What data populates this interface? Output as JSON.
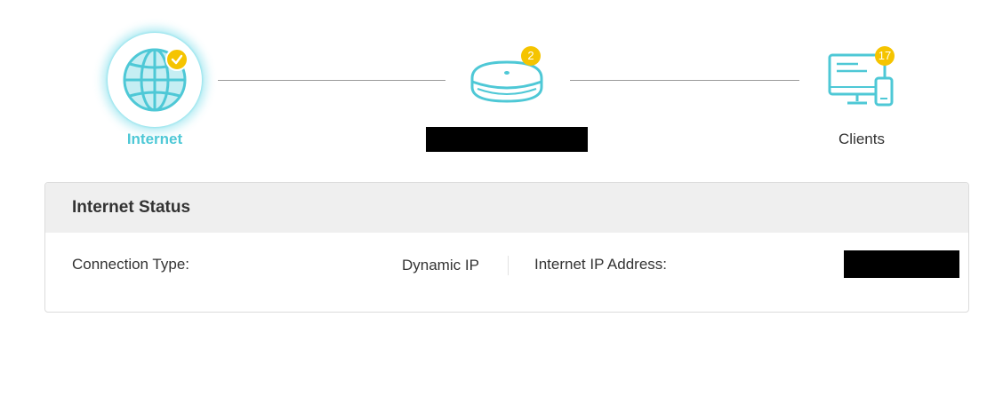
{
  "topology": {
    "internet": {
      "label": "Internet",
      "icon": "globe-icon",
      "status_icon": "check-icon",
      "accent": "#4ec8d6"
    },
    "router": {
      "label": "",
      "icon": "router-icon",
      "badge_count": "2"
    },
    "clients": {
      "label": "Clients",
      "icon": "computer-phone-icon",
      "badge_count": "17"
    },
    "badge_color": "#f5c400"
  },
  "internet_status": {
    "title": "Internet Status",
    "connection_type_label": "Connection Type:",
    "connection_type_value": "Dynamic IP",
    "ip_address_label": "Internet IP Address:",
    "ip_address_value": ""
  }
}
